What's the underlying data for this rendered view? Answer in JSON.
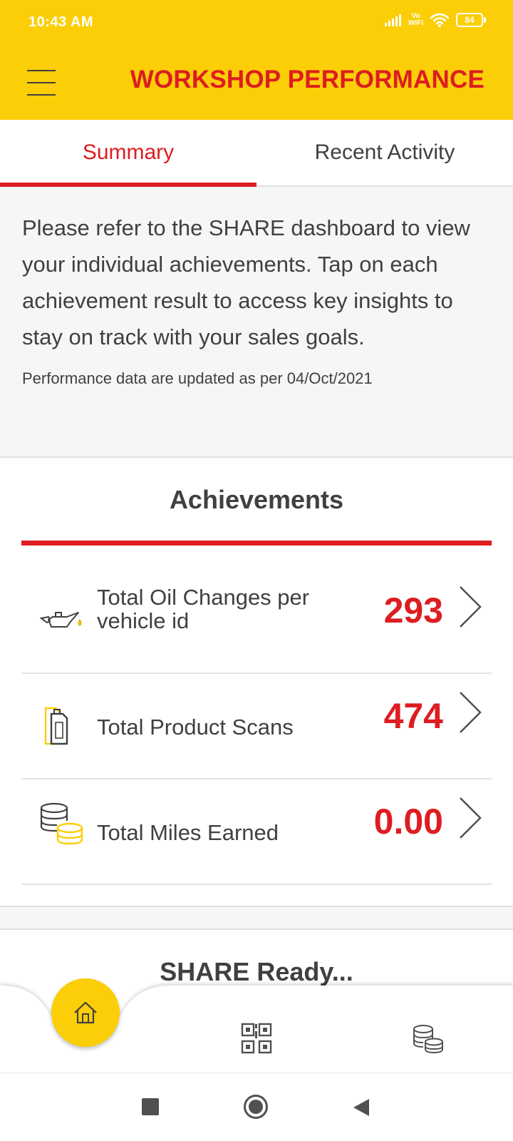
{
  "status_bar": {
    "time": "10:43 AM",
    "network": "Vo WiFi",
    "battery": "84",
    "icons": [
      "signal-icon",
      "vowifi-icon",
      "wifi-icon",
      "battery-icon"
    ]
  },
  "header": {
    "title": "WORKSHOP PERFORMANCE",
    "menu_icon": "hamburger-menu-icon"
  },
  "tabs": [
    {
      "label": "Summary",
      "active": true
    },
    {
      "label": "Recent Activity",
      "active": false
    }
  ],
  "info": {
    "text": "Please refer to the SHARE dashboard to view your individual achievements. Tap on each achievement result to access key insights to stay on track with your sales goals.",
    "updated": "Performance data are updated as per 04/Oct/2021"
  },
  "achievements": {
    "title": "Achievements",
    "items": [
      {
        "label_line1": "Total Oil Changes per",
        "label_line2": "vehicle id",
        "value": "293",
        "icon": "oil-can-icon"
      },
      {
        "label": "Total Product Scans",
        "value": "474",
        "icon": "lubricant-bottle-icon"
      },
      {
        "label": "Total Miles Earned",
        "value": "0.00",
        "icon": "coins-stack-icon"
      }
    ]
  },
  "next_section": {
    "title": "SHARE Ready..."
  },
  "bottom_nav": {
    "items": [
      "home-icon",
      "qr-code-icon",
      "coins-icon"
    ]
  },
  "system_nav": {
    "items": [
      "recents-square-icon",
      "home-circle-icon",
      "back-triangle-icon"
    ]
  },
  "colors": {
    "brand_yellow": "#fbce07",
    "brand_red": "#dd1d21",
    "text_dark": "#404040",
    "panel_grey": "#f6f6f6"
  }
}
